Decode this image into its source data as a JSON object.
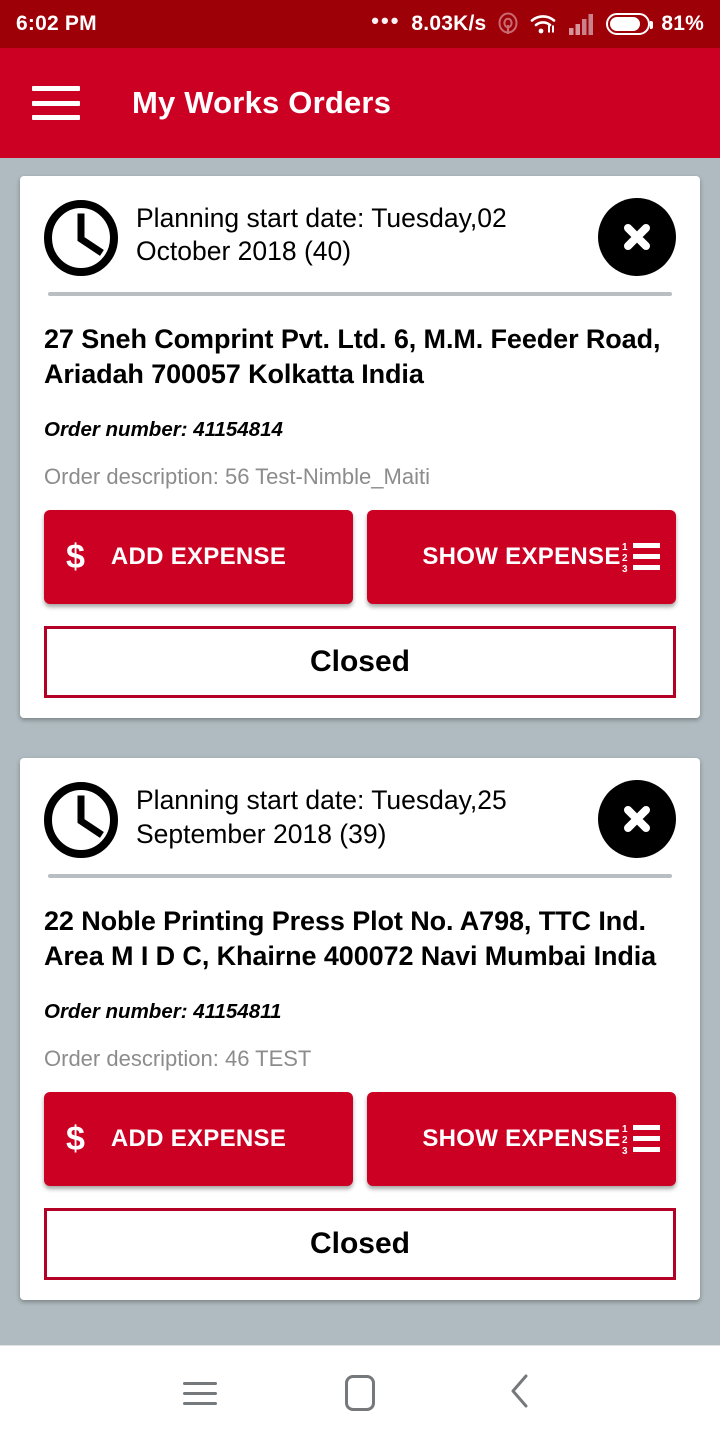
{
  "status_bar": {
    "time": "6:02 PM",
    "overflow_dots": "•••",
    "network_speed": "8.03K/s",
    "hotspot_icon": "hotspot-icon",
    "wifi_icon": "wifi-icon",
    "signal_icon": "cellular-signal-icon",
    "battery_icon": "battery-icon",
    "battery_percent": "81%",
    "battery_level": 81,
    "background_color": "#9E0008"
  },
  "app_bar": {
    "menu_icon": "hamburger-menu-icon",
    "title": "My Works Orders",
    "background_color": "#CC0022"
  },
  "theme": {
    "accent_red": "#CC0022",
    "dark_red": "#9E0008",
    "page_background": "#AFBBC0",
    "status_border": "#B50026",
    "muted_text": "#8C8C8C"
  },
  "orders": [
    {
      "clock_icon": "clock-icon",
      "planning_date": "Planning start date: Tuesday,02 October 2018 (40)",
      "close_icon": "close-x-icon",
      "address": "27 Sneh Comprint Pvt. Ltd. 6, M.M. Feeder Road, Ariadah 700057 Kolkatta India",
      "order_number": "Order number: 41154814",
      "order_description": "Order description: 56 Test-Nimble_Maiti",
      "add_expense_label": "ADD EXPENSE",
      "add_expense_icon": "dollar-icon",
      "show_expense_label": "SHOW EXPENSE",
      "show_expense_icon": "numbered-list-icon",
      "status_label": "Closed"
    },
    {
      "clock_icon": "clock-icon",
      "planning_date": "Planning start date: Tuesday,25 September 2018 (39)",
      "close_icon": "close-x-icon",
      "address": "22 Noble Printing Press Plot No. A798, TTC Ind. Area M I D C, Khairne 400072 Navi Mumbai India",
      "order_number": "Order number: 41154811",
      "order_description": "Order description: 46 TEST",
      "add_expense_label": "ADD EXPENSE",
      "add_expense_icon": "dollar-icon",
      "show_expense_label": "SHOW EXPENSE",
      "show_expense_icon": "numbered-list-icon",
      "status_label": "Closed"
    }
  ],
  "nav_bar": {
    "recents_icon": "recents-icon",
    "home_icon": "home-icon",
    "back_icon": "back-chevron-icon"
  }
}
